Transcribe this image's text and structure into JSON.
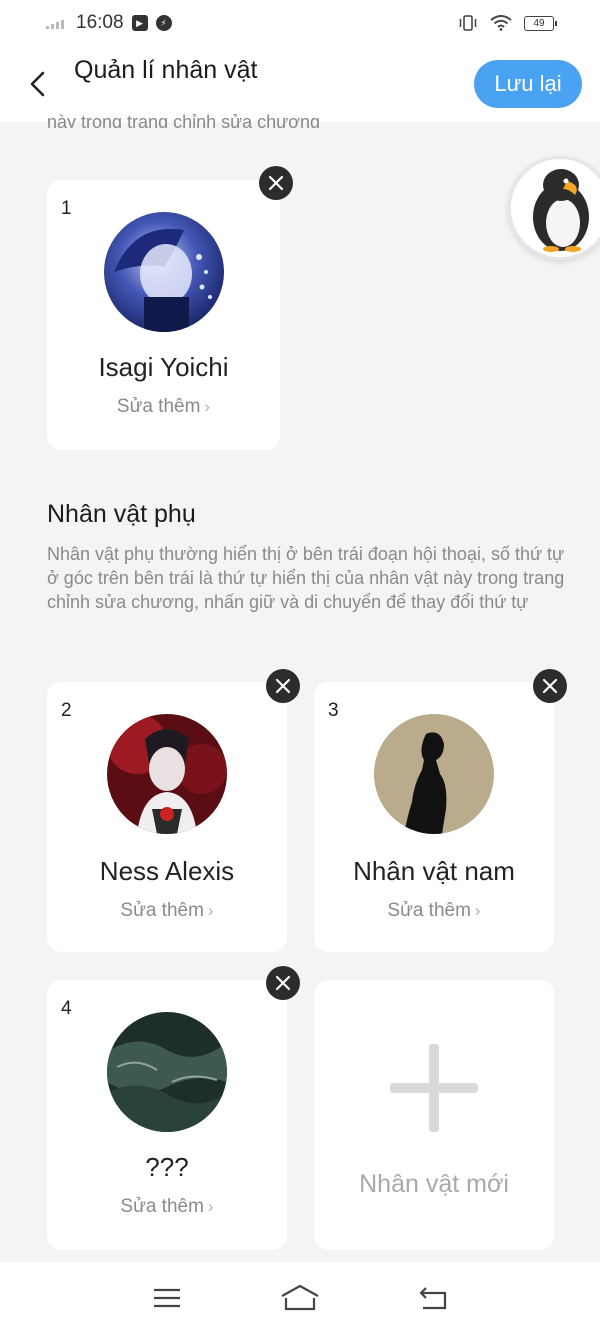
{
  "status_bar": {
    "time": "16:08",
    "battery": "49"
  },
  "header": {
    "title": "Quản lí nhân vật",
    "save_label": "Lưu lại"
  },
  "clipped_text": "này trong trang chỉnh sửa chương",
  "main_character": {
    "number": "1",
    "name": "Isagi Yoichi",
    "edit_label": "Sửa thêm"
  },
  "supporting": {
    "title": "Nhân vật phụ",
    "description": "Nhân vật phụ thường hiển thị ở bên trái đoạn hội thoại, số thứ tự ở góc trên bên trái là thứ tự hiển thị của nhân vật này trong trang chỉnh sửa chương, nhấn giữ và di chuyển để thay đổi thứ tự",
    "characters": [
      {
        "number": "2",
        "name": "Ness Alexis",
        "edit_label": "Sửa thêm"
      },
      {
        "number": "3",
        "name": "Nhân vật nam",
        "edit_label": "Sửa thêm"
      },
      {
        "number": "4",
        "name": "???",
        "edit_label": "Sửa thêm"
      }
    ],
    "new_label": "Nhân vật mới"
  },
  "icons": {
    "back": "chevron-left-icon",
    "delete": "close-icon",
    "add": "plus-icon",
    "nav_menu": "menu-icon",
    "nav_home": "home-icon",
    "nav_back": "back-icon"
  },
  "colors": {
    "accent": "#4aa3f2",
    "background": "#f4f4f5",
    "card": "#ffffff",
    "delete_button": "#2c2c2c"
  }
}
